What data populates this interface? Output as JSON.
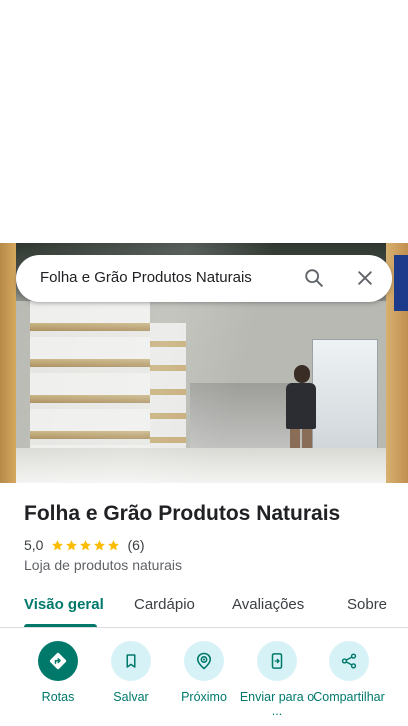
{
  "search": {
    "query": "Folha e Grão Produtos Naturais",
    "search_icon": "search-icon",
    "close_icon": "close-icon"
  },
  "place": {
    "name": "Folha e Grão Produtos Naturais",
    "rating": "5,0",
    "rating_value": 5,
    "stars_max": 5,
    "review_count": "(6)",
    "category": "Loja de produtos naturais"
  },
  "tabs": [
    {
      "label": "Visão geral",
      "active": true
    },
    {
      "label": "Cardápio",
      "active": false
    },
    {
      "label": "Avaliações",
      "active": false
    },
    {
      "label": "Sobre",
      "active": false
    }
  ],
  "actions": [
    {
      "label": "Rotas",
      "icon": "directions-icon",
      "primary": true
    },
    {
      "label": "Salvar",
      "icon": "bookmark-icon",
      "primary": false
    },
    {
      "label": "Próximo",
      "icon": "nearby-icon",
      "primary": false
    },
    {
      "label": "Enviar para o ...",
      "icon": "send-to-phone-icon",
      "primary": false
    },
    {
      "label": "Compartilhar",
      "icon": "share-icon",
      "primary": false
    }
  ],
  "colors": {
    "accent": "#00796b",
    "action_bg": "#d6f2f6",
    "star": "#fbbc04",
    "text_primary": "#202124",
    "text_secondary": "#5f6368"
  }
}
